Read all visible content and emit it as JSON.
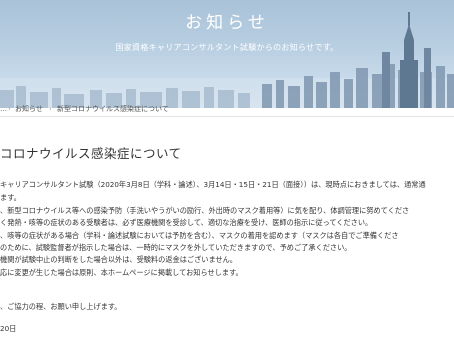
{
  "hero": {
    "title": "お知らせ",
    "subtitle": "国家資格キャリアコンサルタント試験からのお知らせです。"
  },
  "breadcrumb": {
    "items": [
      "…",
      "お知らせ",
      "新型コロナウイルス感染症について"
    ]
  },
  "article": {
    "title": "コロナウイルス感染症について",
    "lines": [
      "キャリアコンサルタント試験（2020年3月8日（学科・論述）、3月14日・15日・21日（面接））は、現時点におきましては、通常通",
      "ます。",
      "、新型コロナウイルス等への感染予防（手洗いやうがいの励行、外出時のマスク着用等）に気を配り、体調管理に努めてくださ",
      "く発熱・咳等の症状のある受験者は、必ず医療機関を受診して、適切な治療を受け、医師の指示に従ってください。",
      "、咳等の症状がある場合（学科・論述試験においては予防を含む）、マスクの着用を認めます（マスクは各自でご準備くださ",
      "のために、試験監督者が指示した場合は、一時的にマスクを外していただきますので、予めご了承ください。",
      "機関が試験中止の判断をした場合以外は、受験料の返金はございません。",
      "応に変更が生じた場合は原則、本ホームページに掲載してお知らせします。",
      "、ご協力の程、お願い申し上げます。",
      "20日"
    ]
  }
}
